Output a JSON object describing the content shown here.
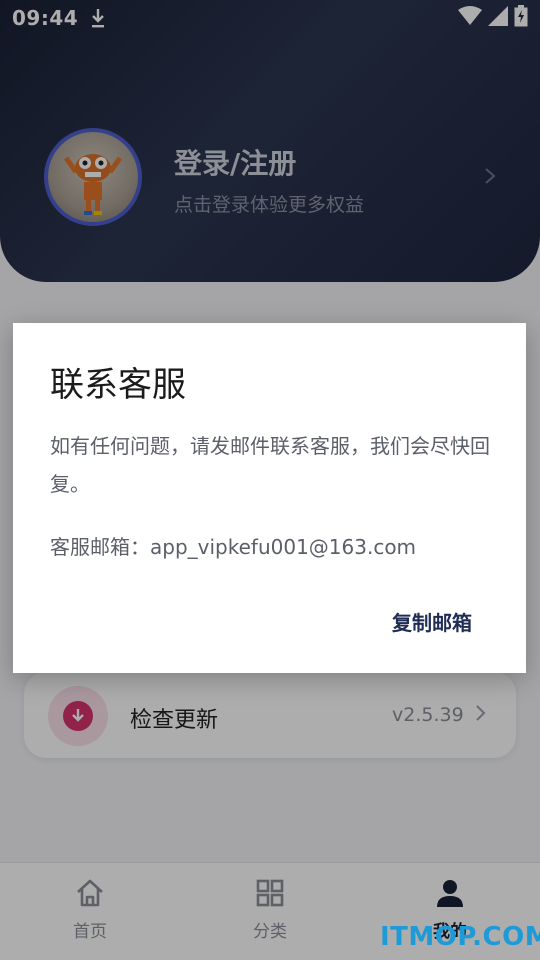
{
  "status_bar": {
    "time": "09:44",
    "icons": [
      "download-icon",
      "wifi-icon",
      "signal-icon",
      "battery-charging-icon"
    ]
  },
  "profile": {
    "title": "登录/注册",
    "subtitle": "点击登录体验更多权益",
    "avatar_icon": "cartoon-avatar"
  },
  "update_row": {
    "label": "检查更新",
    "version": "v2.5.39",
    "icon": "download-circle-icon",
    "accent_color": "#d6336c"
  },
  "bottom_nav": {
    "items": [
      {
        "label": "首页",
        "icon": "home-icon"
      },
      {
        "label": "分类",
        "icon": "grid-icon"
      },
      {
        "label": "我的",
        "icon": "person-icon",
        "active": true
      }
    ]
  },
  "dialog": {
    "title": "联系客服",
    "body": "如有任何问题，请发邮件联系客服，我们会尽快回复。",
    "email_line": "客服邮箱：app_vipkefu001@163.com",
    "copy_button": "复制邮箱"
  },
  "watermark": "ITMOP.COM",
  "colors": {
    "header_bg": "#1f2740",
    "avatar_ring": "#4d5fcf",
    "button_text": "#1f2d55",
    "watermark": "#1e9ad6"
  }
}
